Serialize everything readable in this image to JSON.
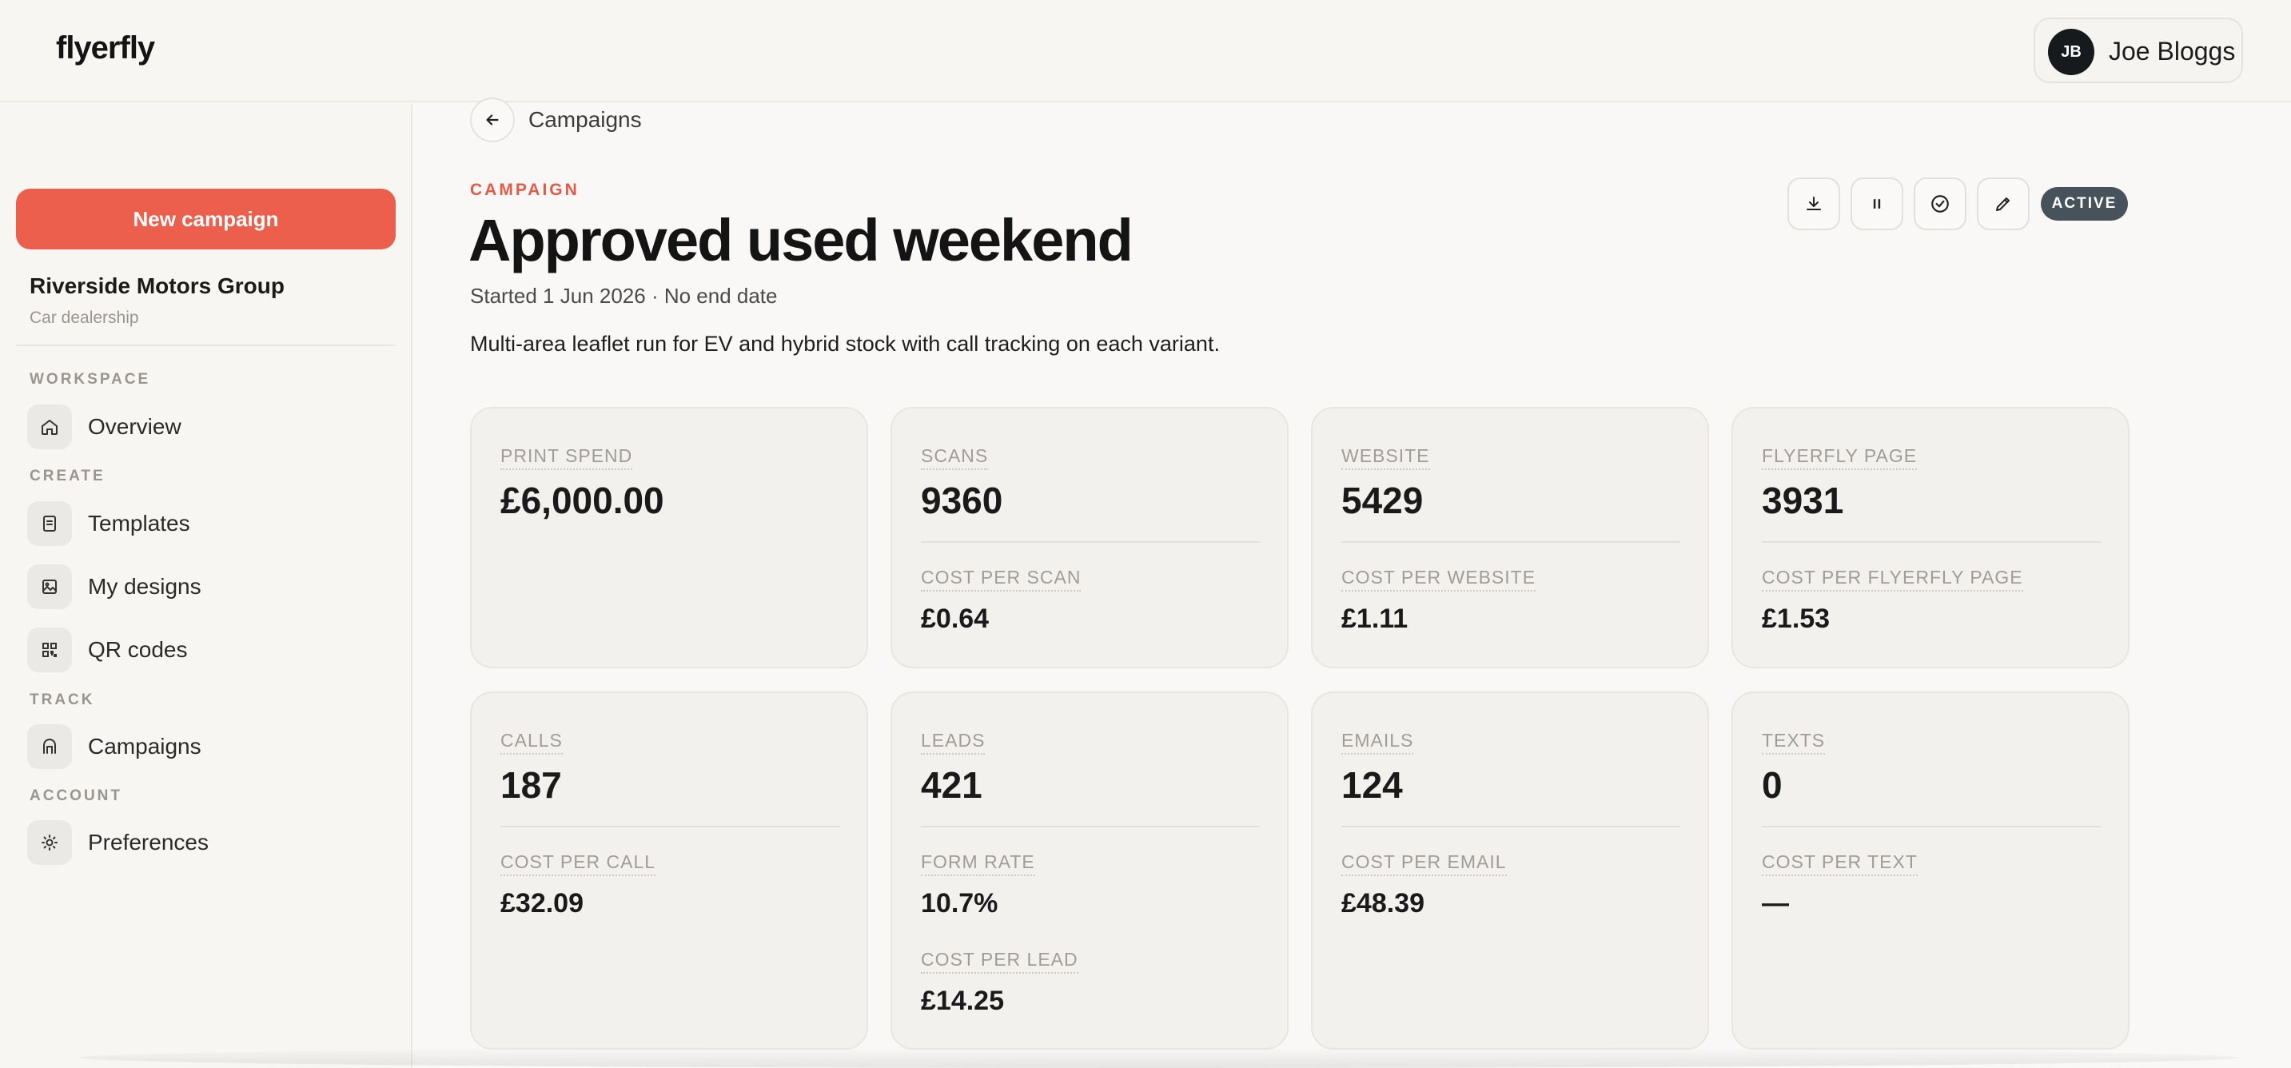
{
  "app": {
    "logo": "flyerfly"
  },
  "user": {
    "initials": "JB",
    "name": "Joe Bloggs"
  },
  "sidebar": {
    "new_campaign_label": "New campaign",
    "org_name": "Riverside Motors Group",
    "org_type": "Car dealership",
    "sections": {
      "workspace": "WORKSPACE",
      "create": "CREATE",
      "track": "TRACK",
      "account": "ACCOUNT"
    },
    "items": {
      "overview": "Overview",
      "templates": "Templates",
      "my_designs": "My designs",
      "qr_codes": "QR codes",
      "campaigns": "Campaigns",
      "preferences": "Preferences"
    }
  },
  "header": {
    "back_label": "Campaigns",
    "eyebrow": "CAMPAIGN",
    "title": "Approved used weekend",
    "dates": "Started 1 Jun 2026 · No end date",
    "description": "Multi-area leaflet run for EV and hybrid stock with call tracking on each variant.",
    "status": "ACTIVE"
  },
  "metrics": {
    "print_spend": {
      "label": "PRINT SPEND",
      "value": "£6,000.00"
    },
    "scans": {
      "label": "SCANS",
      "value": "9360",
      "sub_label": "COST PER SCAN",
      "sub_value": "£0.64"
    },
    "website": {
      "label": "WEBSITE",
      "value": "5429",
      "sub_label": "COST PER WEBSITE",
      "sub_value": "£1.11"
    },
    "flyerfly_page": {
      "label": "FLYERFLY PAGE",
      "value": "3931",
      "sub_label": "COST PER FLYERFLY PAGE",
      "sub_value": "£1.53"
    },
    "calls": {
      "label": "CALLS",
      "value": "187",
      "sub_label": "COST PER CALL",
      "sub_value": "£32.09"
    },
    "leads": {
      "label": "LEADS",
      "value": "421",
      "sub_label": "FORM RATE",
      "sub_value": "10.7%",
      "sub_label2": "COST PER LEAD",
      "sub_value2": "£14.25"
    },
    "emails": {
      "label": "EMAILS",
      "value": "124",
      "sub_label": "COST PER EMAIL",
      "sub_value": "£48.39"
    },
    "texts": {
      "label": "TEXTS",
      "value": "0",
      "sub_label": "COST PER TEXT",
      "sub_value": "—"
    }
  },
  "colors": {
    "accent": "#ec5f4c",
    "eyebrow": "#e05a47",
    "badge": "#47525a",
    "background": "#f9f8f6"
  },
  "icons": {
    "back": "arrow-left-icon",
    "download": "download-icon",
    "pause": "pause-icon",
    "complete": "check-circle-icon",
    "edit": "pencil-icon"
  }
}
